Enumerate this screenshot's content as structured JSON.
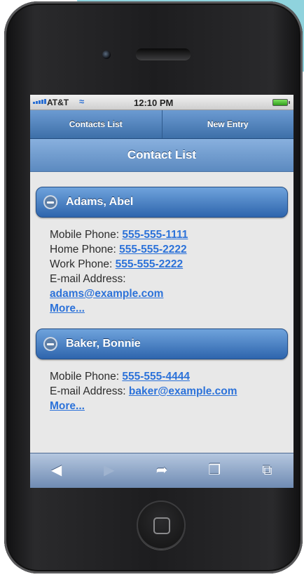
{
  "status_bar": {
    "carrier": "AT&T",
    "time": "12:10 PM"
  },
  "nav": {
    "tab_contacts": "Contacts List",
    "tab_new": "New Entry"
  },
  "header": {
    "title": "Contact List"
  },
  "contacts": [
    {
      "name": "Adams, Abel",
      "rows": [
        {
          "label": "Mobile Phone: ",
          "value": "555-555-1111"
        },
        {
          "label": "Home Phone: ",
          "value": "555-555-2222"
        },
        {
          "label": "Work Phone: ",
          "value": "555-555-2222"
        },
        {
          "label": "E-mail Address:",
          "value": ""
        }
      ],
      "email": "adams@example.com",
      "more": "More..."
    },
    {
      "name": "Baker, Bonnie",
      "rows": [
        {
          "label": "Mobile Phone: ",
          "value": "555-555-4444"
        },
        {
          "label": "E-mail Address: ",
          "value": "baker@example.com"
        }
      ],
      "more": "More..."
    }
  ],
  "toolbar": {
    "icons": [
      "back-icon",
      "forward-icon",
      "share-icon",
      "bookmarks-icon",
      "tabs-icon"
    ]
  },
  "colors": {
    "nav_blue": "#3d6fa8",
    "header_blue": "#5c8ac0",
    "link_blue": "#2c72d9",
    "accent_teal": "#8fd3dd"
  }
}
